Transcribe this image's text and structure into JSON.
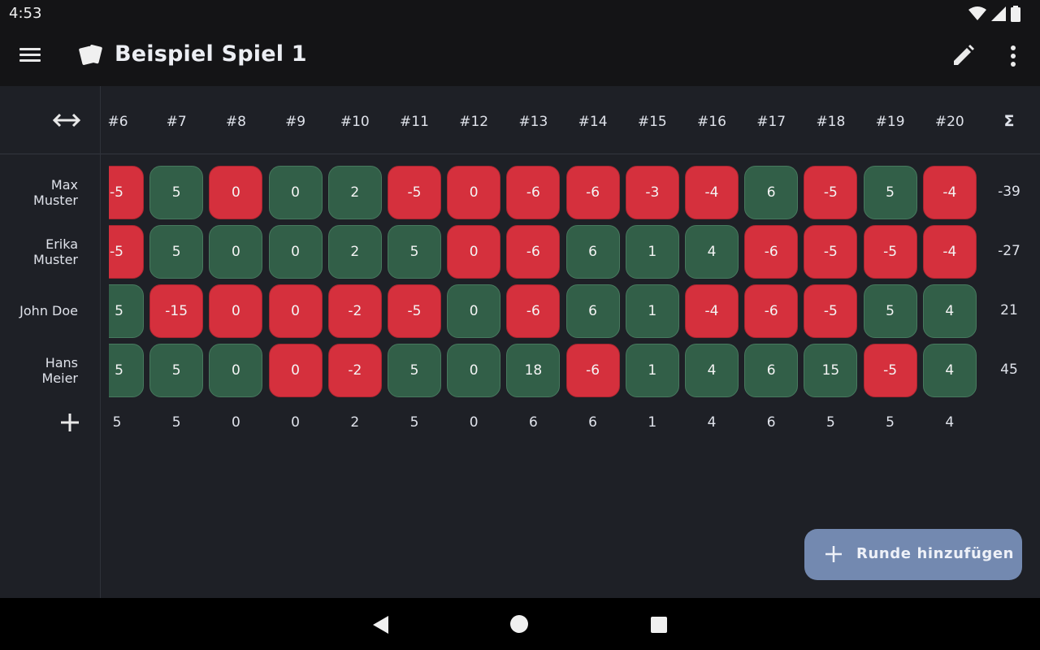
{
  "status_bar": {
    "time": "4:53",
    "icons": [
      "wifi-icon",
      "signal-icon",
      "battery-icon"
    ]
  },
  "app_bar": {
    "title": "Beispiel Spiel 1",
    "logo_icon": "cards-icon",
    "left_icon": "menu-icon",
    "right_icons": [
      "edit-icon",
      "more-vert-icon"
    ]
  },
  "table": {
    "swap_icon": "swap-horizontal-icon",
    "rounds": [
      "#6",
      "#7",
      "#8",
      "#9",
      "#10",
      "#11",
      "#12",
      "#13",
      "#14",
      "#15",
      "#16",
      "#17",
      "#18",
      "#19",
      "#20"
    ],
    "sum_label": "Σ",
    "players": [
      {
        "name": "Max Muster",
        "scores": [
          "-5",
          "5",
          "0",
          "0",
          "2",
          "-5",
          "0",
          "-6",
          "-6",
          "-3",
          "-4",
          "6",
          "-5",
          "5",
          "-4"
        ],
        "total": "-39"
      },
      {
        "name": "Erika Muster",
        "scores": [
          "-5",
          "5",
          "0",
          "0",
          "2",
          "5",
          "0",
          "-6",
          "6",
          "1",
          "4",
          "-6",
          "-5",
          "-5",
          "-4"
        ],
        "total": "-27"
      },
      {
        "name": "John Doe",
        "scores": [
          "5",
          "-15",
          "0",
          "0",
          "-2",
          "-5",
          "0",
          "-6",
          "6",
          "1",
          "-4",
          "-6",
          "-5",
          "5",
          "4"
        ],
        "total": "21"
      },
      {
        "name": "Hans Meier",
        "scores": [
          "5",
          "5",
          "0",
          "0",
          "-2",
          "5",
          "0",
          "18",
          "-6",
          "1",
          "4",
          "6",
          "15",
          "-5",
          "4"
        ],
        "total": "45"
      }
    ],
    "cell_states": [
      [
        "neg",
        "pos",
        "neg",
        "pos",
        "pos",
        "neg",
        "neg",
        "neg",
        "neg",
        "neg",
        "neg",
        "pos",
        "neg",
        "pos",
        "neg"
      ],
      [
        "neg",
        "pos",
        "pos",
        "pos",
        "pos",
        "pos",
        "neg",
        "neg",
        "pos",
        "pos",
        "pos",
        "neg",
        "neg",
        "neg",
        "neg"
      ],
      [
        "pos",
        "neg",
        "neg",
        "neg",
        "neg",
        "neg",
        "pos",
        "neg",
        "pos",
        "pos",
        "neg",
        "neg",
        "neg",
        "pos",
        "pos"
      ],
      [
        "pos",
        "pos",
        "pos",
        "neg",
        "neg",
        "pos",
        "pos",
        "pos",
        "neg",
        "pos",
        "pos",
        "pos",
        "pos",
        "neg",
        "pos"
      ]
    ],
    "add_player_icon": "plus-icon",
    "row_values": [
      "5",
      "5",
      "0",
      "0",
      "2",
      "5",
      "0",
      "6",
      "6",
      "1",
      "4",
      "6",
      "5",
      "5",
      "4"
    ]
  },
  "fab": {
    "label": "Runde hinzufügen",
    "icon": "plus-icon"
  },
  "colors": {
    "negative": "#d5303d",
    "positive": "#325f48",
    "fab": "#7389b0",
    "background": "#1e2026",
    "bar": "#141416"
  },
  "nav_bar": {
    "icons": [
      "back-icon",
      "home-icon",
      "recents-icon"
    ]
  }
}
